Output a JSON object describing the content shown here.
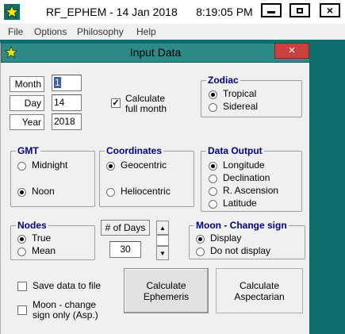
{
  "window": {
    "title": "RF_EPHEM - 14 Jan 2018",
    "time": "8:19:05 PM"
  },
  "menu": [
    "File",
    "Options",
    "Philosophy",
    "Help"
  ],
  "dialog": {
    "title": "Input Data",
    "close_glyph": "×",
    "date": {
      "month_label": "Month",
      "month_value": "1",
      "day_label": "Day",
      "day_value": "14",
      "year_label": "Year",
      "year_value": "2018"
    },
    "calc_full_month": {
      "label_line1": "Calculate",
      "label_line2": "full month",
      "checked": true
    },
    "zodiac": {
      "title": "Zodiac",
      "options": [
        "Tropical",
        "Sidereal"
      ],
      "selected": "Tropical"
    },
    "gmt": {
      "title": "GMT",
      "options": [
        "Midnight",
        "Noon"
      ],
      "selected": "Noon"
    },
    "coordinates": {
      "title": "Coordinates",
      "options": [
        "Geocentric",
        "Heliocentric"
      ],
      "selected": "Geocentric"
    },
    "data_output": {
      "title": "Data Output",
      "options": [
        "Longitude",
        "Declination",
        "R. Ascension",
        "Latitude"
      ],
      "selected": "Longitude"
    },
    "nodes": {
      "title": "Nodes",
      "options": [
        "True",
        "Mean"
      ],
      "selected": "True"
    },
    "days": {
      "label": "# of Days",
      "value": "30"
    },
    "moon_change_sign": {
      "title": "Moon - Change sign",
      "options": [
        "Display",
        "Do not display"
      ],
      "selected": "Display"
    },
    "save_to_file": {
      "label": "Save data to file",
      "checked": false
    },
    "moon_change_sign_only": {
      "label_line1": "Moon - change",
      "label_line2": "sign only (Asp.)",
      "checked": false
    },
    "buttons": {
      "ephemeris": {
        "line1": "Calculate",
        "line2": "Ephemeris"
      },
      "aspectarian": {
        "line1": "Calculate",
        "line2": "Aspectarian"
      }
    }
  },
  "colors": {
    "teal": "#0f6e6b",
    "group_title": "#000080",
    "close_red": "#c94040"
  }
}
